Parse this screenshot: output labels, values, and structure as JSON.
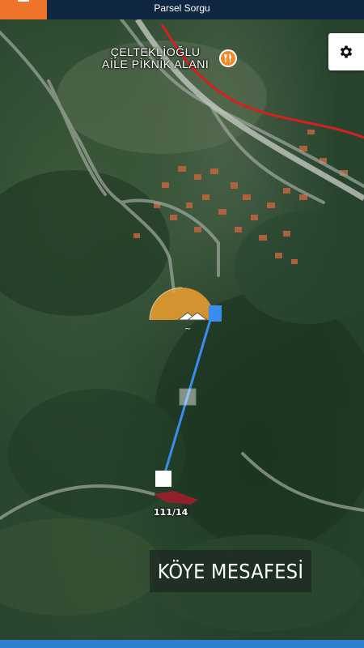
{
  "header": {
    "title": "Parsel Sorgu",
    "menu_icon": "hamburger-icon",
    "accent": "#f0732a",
    "bg": "#0f2740"
  },
  "settings": {
    "icon": "gear-icon"
  },
  "map": {
    "poi_name_line1": "ÇELTEKLİOĞLU",
    "poi_name_line2": "AİLE PİKNİK ALANI",
    "poi_icon": "restaurant-icon",
    "parcel_label": "111/14",
    "distance_label": "~",
    "caption": "KÖYE MESAFESİ",
    "road_color": "#d62020",
    "line_color": "#3a8df0"
  }
}
